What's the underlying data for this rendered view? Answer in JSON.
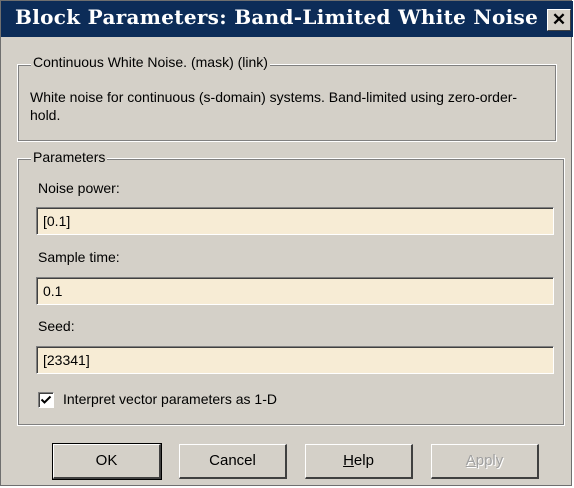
{
  "window": {
    "title": "Block Parameters: Band-Limited White Noise",
    "close_glyph": "✕"
  },
  "description_group": {
    "legend": "Continuous White Noise. (mask) (link)",
    "text": "White noise for continuous (s-domain) systems.  Band-limited using zero-order-hold."
  },
  "parameters_group": {
    "legend": "Parameters",
    "noise_power": {
      "label": "Noise power:",
      "value": "[0.1]"
    },
    "sample_time": {
      "label": "Sample time:",
      "value": "0.1"
    },
    "seed": {
      "label": "Seed:",
      "value": "[23341]"
    },
    "interpret_vector": {
      "label": "Interpret vector parameters as 1-D",
      "checked": true
    }
  },
  "buttons": {
    "ok": "OK",
    "cancel": "Cancel",
    "help_mnemonic": "H",
    "help_rest": "elp",
    "apply_mnemonic": "A",
    "apply_rest": "pply"
  },
  "colors": {
    "titlebar": "#0c2c58",
    "dialog": "#d4d0c8",
    "field": "#f7ecd5"
  },
  "icons": {
    "checkbox": "checkmark-icon",
    "close": "close-icon"
  }
}
